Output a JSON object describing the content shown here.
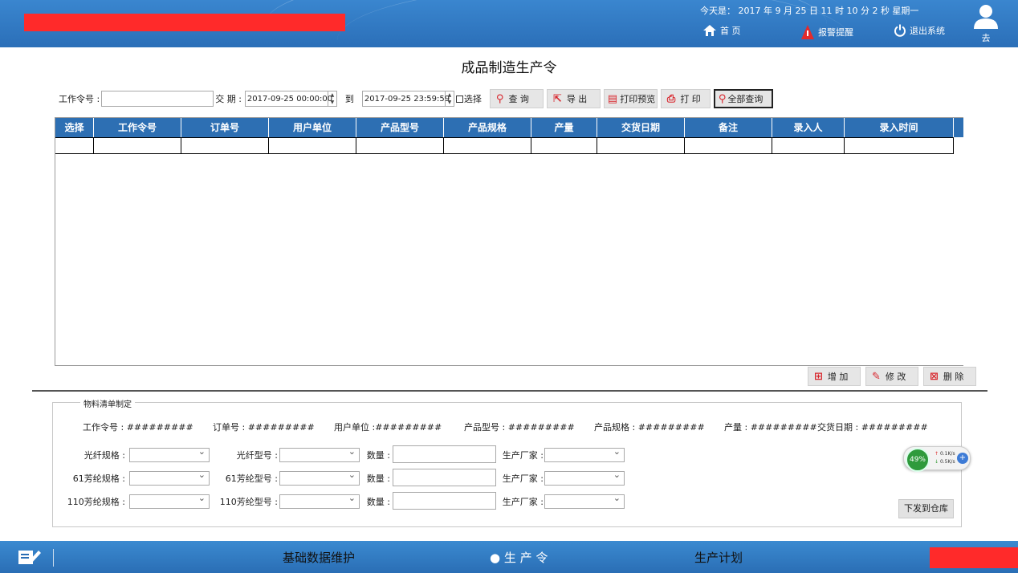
{
  "header": {
    "datetime": "今天是： 2017 年 9 月 25 日  11 时 10 分 2 秒   星期一",
    "nav": [
      {
        "label": "首  页",
        "icon": "home-icon"
      },
      {
        "label": "报警提醒",
        "icon": "alarm-icon"
      },
      {
        "label": "退出系统",
        "icon": "power-icon"
      }
    ],
    "user_name": "去"
  },
  "page_title": "成品制造生产令",
  "search": {
    "order_label": "工作令号 :",
    "order_value": "",
    "date_label": "交  期 :",
    "date_from": "2017-09-25 00:00:00",
    "to_label": "到",
    "date_to": "2017-09-25 23:59:59",
    "check_label": "选择",
    "buttons": [
      {
        "label": "查  询",
        "icon": "search-icon"
      },
      {
        "label": "导  出",
        "icon": "export-icon"
      },
      {
        "label": "打印预览",
        "icon": "print-preview-icon"
      },
      {
        "label": "打  印",
        "icon": "print-icon"
      },
      {
        "label": "全部查询",
        "icon": "search-all-icon"
      }
    ]
  },
  "table": {
    "columns": [
      "选择",
      "工作令号",
      "订单号",
      "用户单位",
      "产品型号",
      "产品规格",
      "产量",
      "交货日期",
      "备注",
      "录入人",
      "录入时间"
    ],
    "rows": [
      [
        "",
        "",
        "",
        "",
        "",
        "",
        "",
        "",
        "",
        "",
        ""
      ]
    ]
  },
  "actions": [
    {
      "label": "增  加",
      "icon": "add-icon"
    },
    {
      "label": "修  改",
      "icon": "edit-icon"
    },
    {
      "label": "删  除",
      "icon": "delete-icon"
    }
  ],
  "bom": {
    "legend": "物料清单制定",
    "info": [
      {
        "label": "工作令号 :",
        "value": "#########"
      },
      {
        "label": "订单号 :",
        "value": "#########"
      },
      {
        "label": "用户单位 :",
        "value": "#########"
      },
      {
        "label": "产品型号 :",
        "value": "#########"
      },
      {
        "label": "产品规格 :",
        "value": "#########"
      },
      {
        "label": "产量 :",
        "value": "#########"
      },
      {
        "label": "交货日期 :",
        "value": "#########"
      }
    ],
    "rows": [
      {
        "spec_label": "光纤规格 :",
        "model_label": "光纤型号 :",
        "qty_label": "数量 :",
        "maker_label": "生产厂家 :"
      },
      {
        "spec_label": "61芳纶规格 :",
        "model_label": "61芳纶型号 :",
        "qty_label": "数量 :",
        "maker_label": "生产厂家 :"
      },
      {
        "spec_label": "110芳纶规格 :",
        "model_label": "110芳纶型号 :",
        "qty_label": "数量 :",
        "maker_label": "生产厂家 :"
      }
    ],
    "send_label": "下发到仓库"
  },
  "widget": {
    "percent": "49%",
    "up": "0.1K/s",
    "down": "0.5K/s"
  },
  "footer": {
    "tabs": [
      "基础数据维护",
      "● 生 产 令",
      "生产计划"
    ]
  },
  "colors": {
    "header_blue": "#2d6fb3",
    "accent_red": "#d8252c"
  }
}
